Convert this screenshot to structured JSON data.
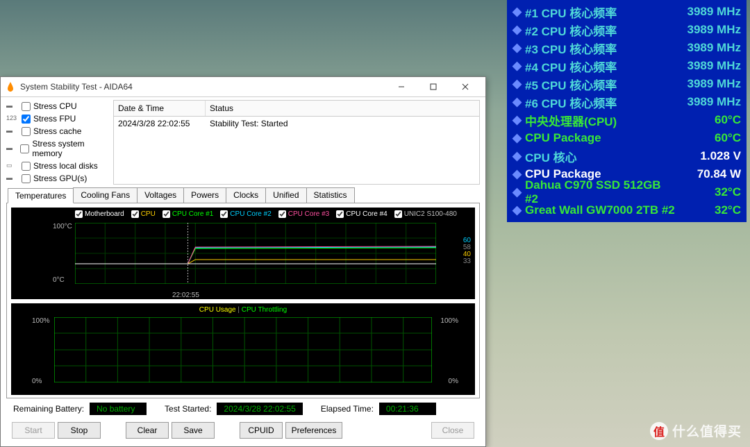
{
  "osd": {
    "rows": [
      {
        "label": "#1 CPU 核心频率",
        "value": "3989 MHz",
        "lc": "c-cyan",
        "vc": "c-cyan"
      },
      {
        "label": "#2 CPU 核心频率",
        "value": "3989 MHz",
        "lc": "c-cyan",
        "vc": "c-cyan"
      },
      {
        "label": "#3 CPU 核心频率",
        "value": "3989 MHz",
        "lc": "c-cyan",
        "vc": "c-cyan"
      },
      {
        "label": "#4 CPU 核心频率",
        "value": "3989 MHz",
        "lc": "c-cyan",
        "vc": "c-cyan"
      },
      {
        "label": "#5 CPU 核心频率",
        "value": "3989 MHz",
        "lc": "c-cyan",
        "vc": "c-cyan"
      },
      {
        "label": "#6 CPU 核心频率",
        "value": "3989 MHz",
        "lc": "c-cyan",
        "vc": "c-cyan"
      },
      {
        "label": "中央处理器(CPU)",
        "value": "60°C",
        "lc": "c-green",
        "vc": "c-green"
      },
      {
        "label": "CPU Package",
        "value": "60°C",
        "lc": "c-green",
        "vc": "c-green"
      },
      {
        "label": "CPU 核心",
        "value": "1.028 V",
        "lc": "c-cyan",
        "vc": "c-white"
      },
      {
        "label": "CPU Package",
        "value": "70.84 W",
        "lc": "c-white",
        "vc": "c-white"
      },
      {
        "label": "Dahua C970 SSD 512GB #2",
        "value": "32°C",
        "lc": "c-green",
        "vc": "c-green"
      },
      {
        "label": "Great Wall GW7000  2TB #2",
        "value": "32°C",
        "lc": "c-green",
        "vc": "c-green"
      }
    ]
  },
  "window": {
    "title": "System Stability Test - AIDA64",
    "stress": [
      {
        "label": "Stress CPU",
        "checked": false
      },
      {
        "label": "Stress FPU",
        "checked": true
      },
      {
        "label": "Stress cache",
        "checked": false
      },
      {
        "label": "Stress system memory",
        "checked": false
      },
      {
        "label": "Stress local disks",
        "checked": false
      },
      {
        "label": "Stress GPU(s)",
        "checked": false
      }
    ],
    "log": {
      "headers": {
        "c1": "Date & Time",
        "c2": "Status"
      },
      "rows": [
        {
          "c1": "2024/3/28 22:02:55",
          "c2": "Stability Test: Started"
        }
      ]
    },
    "tabs": [
      "Temperatures",
      "Cooling Fans",
      "Voltages",
      "Powers",
      "Clocks",
      "Unified",
      "Statistics"
    ],
    "active_tab": "Temperatures",
    "temp_legend": [
      "Motherboard",
      "CPU",
      "CPU Core #1",
      "CPU Core #2",
      "CPU Core #3",
      "CPU Core #4",
      "UNIC2 S100-480"
    ],
    "temp_axis": {
      "top": "100°C",
      "bot": "0°C",
      "time": "22:02:55",
      "r1": "60",
      "r1b": "58",
      "r2": "40",
      "r2b": "33"
    },
    "cpu_legend": {
      "usage": "CPU Usage",
      "throttling": "CPU Throttling",
      "sep": "|"
    },
    "cpu_axis": {
      "l_top": "100%",
      "l_bot": "0%",
      "r_top": "100%",
      "r_bot": "0%"
    },
    "status": {
      "battery_lbl": "Remaining Battery:",
      "battery_val": "No battery",
      "started_lbl": "Test Started:",
      "started_val": "2024/3/28 22:02:55",
      "elapsed_lbl": "Elapsed Time:",
      "elapsed_val": "00:21:36"
    },
    "buttons": {
      "start": "Start",
      "stop": "Stop",
      "clear": "Clear",
      "save": "Save",
      "cpuid": "CPUID",
      "prefs": "Preferences",
      "close": "Close"
    }
  },
  "watermark": {
    "icon": "值",
    "text": "什么值得买"
  },
  "chart_data": {
    "temperature": {
      "type": "line",
      "ylim": [
        0,
        100
      ],
      "unit": "°C",
      "time_marker": "22:02:55",
      "series": [
        {
          "name": "Motherboard",
          "color": "#ffffff",
          "before": 33,
          "after": 40
        },
        {
          "name": "CPU",
          "color": "#ffd000",
          "before": 33,
          "after": 60
        },
        {
          "name": "CPU Core #1",
          "color": "#00ff00",
          "before": 33,
          "after": 58
        },
        {
          "name": "CPU Core #2",
          "color": "#00d0ff",
          "before": 33,
          "after": 60
        },
        {
          "name": "CPU Core #3",
          "color": "#ff50a0",
          "before": 33,
          "after": 58
        },
        {
          "name": "CPU Core #4",
          "color": "#ffffff",
          "before": 33,
          "after": 60
        },
        {
          "name": "UNIC2 S100-480",
          "color": "#c0c0c0",
          "before": 33,
          "after": 33
        }
      ],
      "right_readouts": [
        60,
        58,
        40,
        33
      ]
    },
    "utilization": {
      "type": "line",
      "ylim": [
        0,
        100
      ],
      "unit": "%",
      "series": [
        {
          "name": "CPU Usage",
          "color": "#ffff00",
          "value": 0
        },
        {
          "name": "CPU Throttling",
          "color": "#00ff00",
          "value": 0
        }
      ]
    }
  }
}
